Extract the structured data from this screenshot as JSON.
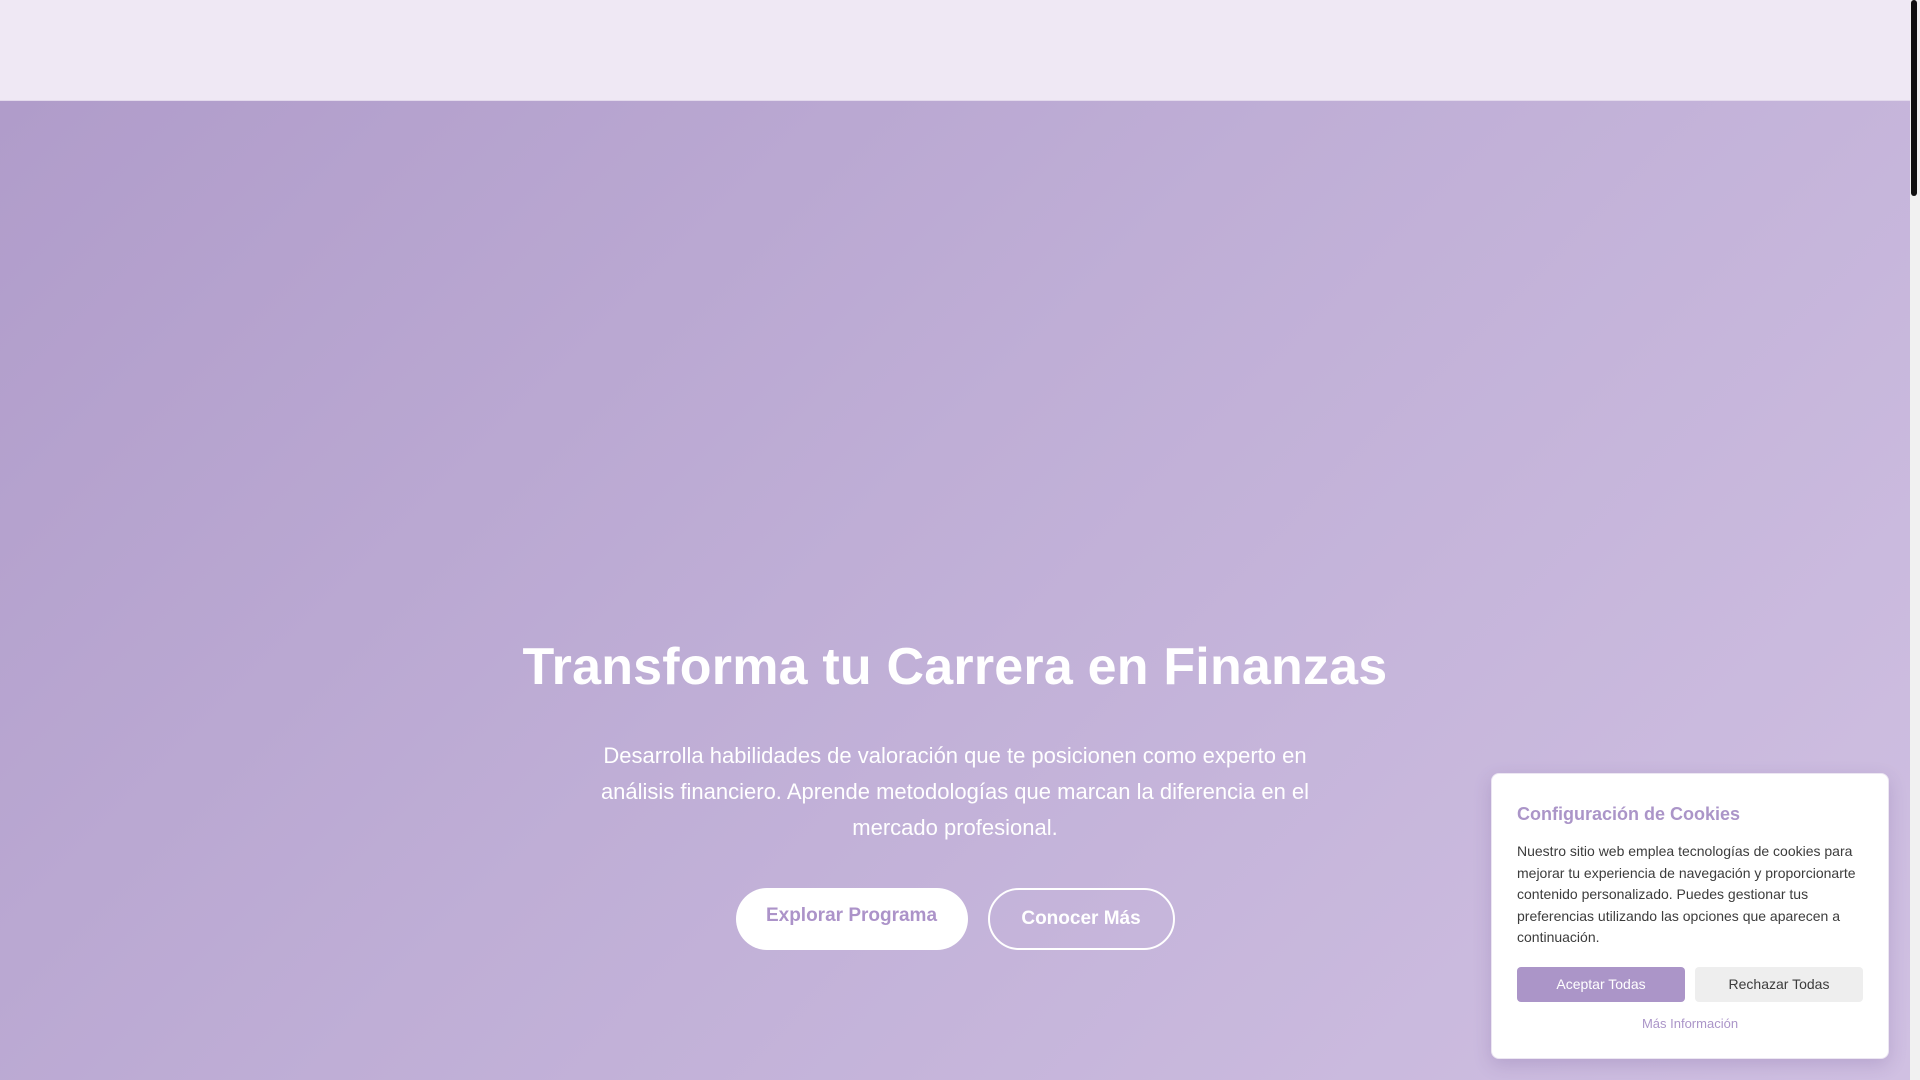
{
  "colors": {
    "nav_background": "#efe8f4",
    "hero_gradient_start": "#b09cca",
    "hero_gradient_end": "#d0c0e2",
    "accent": "#ab95c8",
    "text_on_hero": "#ffffff"
  },
  "hero": {
    "title": "Transforma tu Carrera en Finanzas",
    "subtitle": "Desarrolla habilidades de valoración que te posicionen como experto en análisis financiero. Aprende metodologías que marcan la diferencia en el mercado profesional.",
    "primary_button": "Explorar Programa",
    "secondary_button": "Conocer Más"
  },
  "cookie_banner": {
    "title": "Configuración de Cookies",
    "text": "Nuestro sitio web emplea tecnologías de cookies para mejorar tu experiencia de navegación y proporcionarte contenido personalizado. Puedes gestionar tus preferencias utilizando las opciones que aparecen a continuación.",
    "accept_label": "Aceptar Todas",
    "reject_label": "Rechazar Todas",
    "more_info_label": "Más Información"
  }
}
